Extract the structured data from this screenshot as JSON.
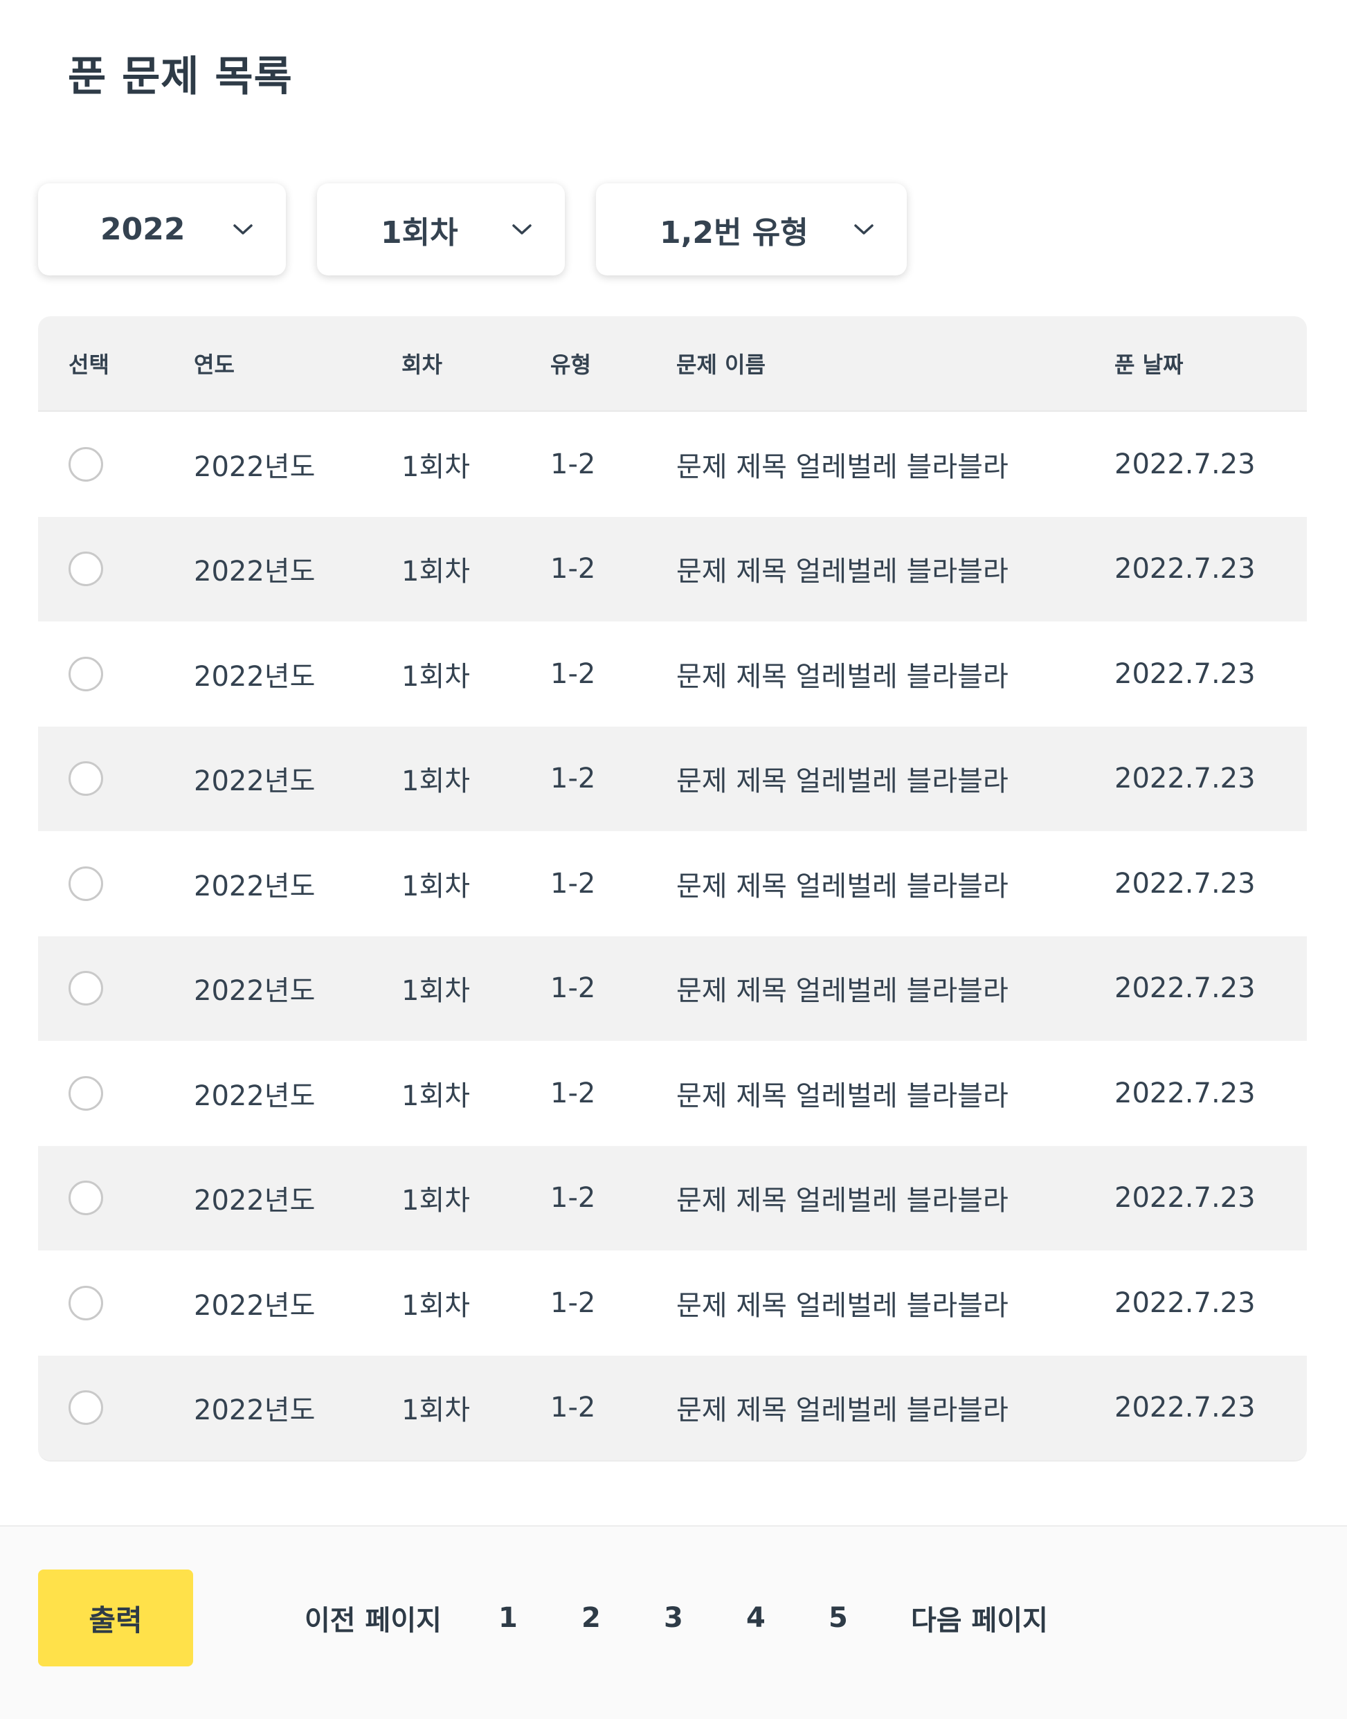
{
  "page": {
    "title": "푼 문제 목록"
  },
  "filters": {
    "year": {
      "selected": "2022"
    },
    "round": {
      "selected": "1회차"
    },
    "type": {
      "selected": "1,2번 유형"
    }
  },
  "table": {
    "headers": {
      "select": "선택",
      "year": "연도",
      "round": "회차",
      "type": "유형",
      "title": "문제 이름",
      "date": "푼 날짜"
    },
    "rows": [
      {
        "year": "2022년도",
        "round": "1회차",
        "type": "1-2",
        "title": "문제 제목 얼레벌레 블라블라",
        "date": "2022.7.23",
        "selected": false
      },
      {
        "year": "2022년도",
        "round": "1회차",
        "type": "1-2",
        "title": "문제 제목 얼레벌레 블라블라",
        "date": "2022.7.23",
        "selected": false
      },
      {
        "year": "2022년도",
        "round": "1회차",
        "type": "1-2",
        "title": "문제 제목 얼레벌레 블라블라",
        "date": "2022.7.23",
        "selected": false
      },
      {
        "year": "2022년도",
        "round": "1회차",
        "type": "1-2",
        "title": "문제 제목 얼레벌레 블라블라",
        "date": "2022.7.23",
        "selected": false
      },
      {
        "year": "2022년도",
        "round": "1회차",
        "type": "1-2",
        "title": "문제 제목 얼레벌레 블라블라",
        "date": "2022.7.23",
        "selected": false
      },
      {
        "year": "2022년도",
        "round": "1회차",
        "type": "1-2",
        "title": "문제 제목 얼레벌레 블라블라",
        "date": "2022.7.23",
        "selected": false
      },
      {
        "year": "2022년도",
        "round": "1회차",
        "type": "1-2",
        "title": "문제 제목 얼레벌레 블라블라",
        "date": "2022.7.23",
        "selected": false
      },
      {
        "year": "2022년도",
        "round": "1회차",
        "type": "1-2",
        "title": "문제 제목 얼레벌레 블라블라",
        "date": "2022.7.23",
        "selected": false
      },
      {
        "year": "2022년도",
        "round": "1회차",
        "type": "1-2",
        "title": "문제 제목 얼레벌레 블라블라",
        "date": "2022.7.23",
        "selected": false
      },
      {
        "year": "2022년도",
        "round": "1회차",
        "type": "1-2",
        "title": "문제 제목 얼레벌레 블라블라",
        "date": "2022.7.23",
        "selected": false
      }
    ]
  },
  "footer": {
    "print_label": "출력",
    "prev_label": "이전 페이지",
    "next_label": "다음 페이지",
    "pages": [
      "1",
      "2",
      "3",
      "4",
      "5"
    ]
  },
  "colors": {
    "accent": "#ffe14a",
    "text": "#344250",
    "row_alt": "#f2f2f2"
  },
  "icons": {
    "dropdown": "chevron-down-icon",
    "row_select": "radio-button"
  }
}
